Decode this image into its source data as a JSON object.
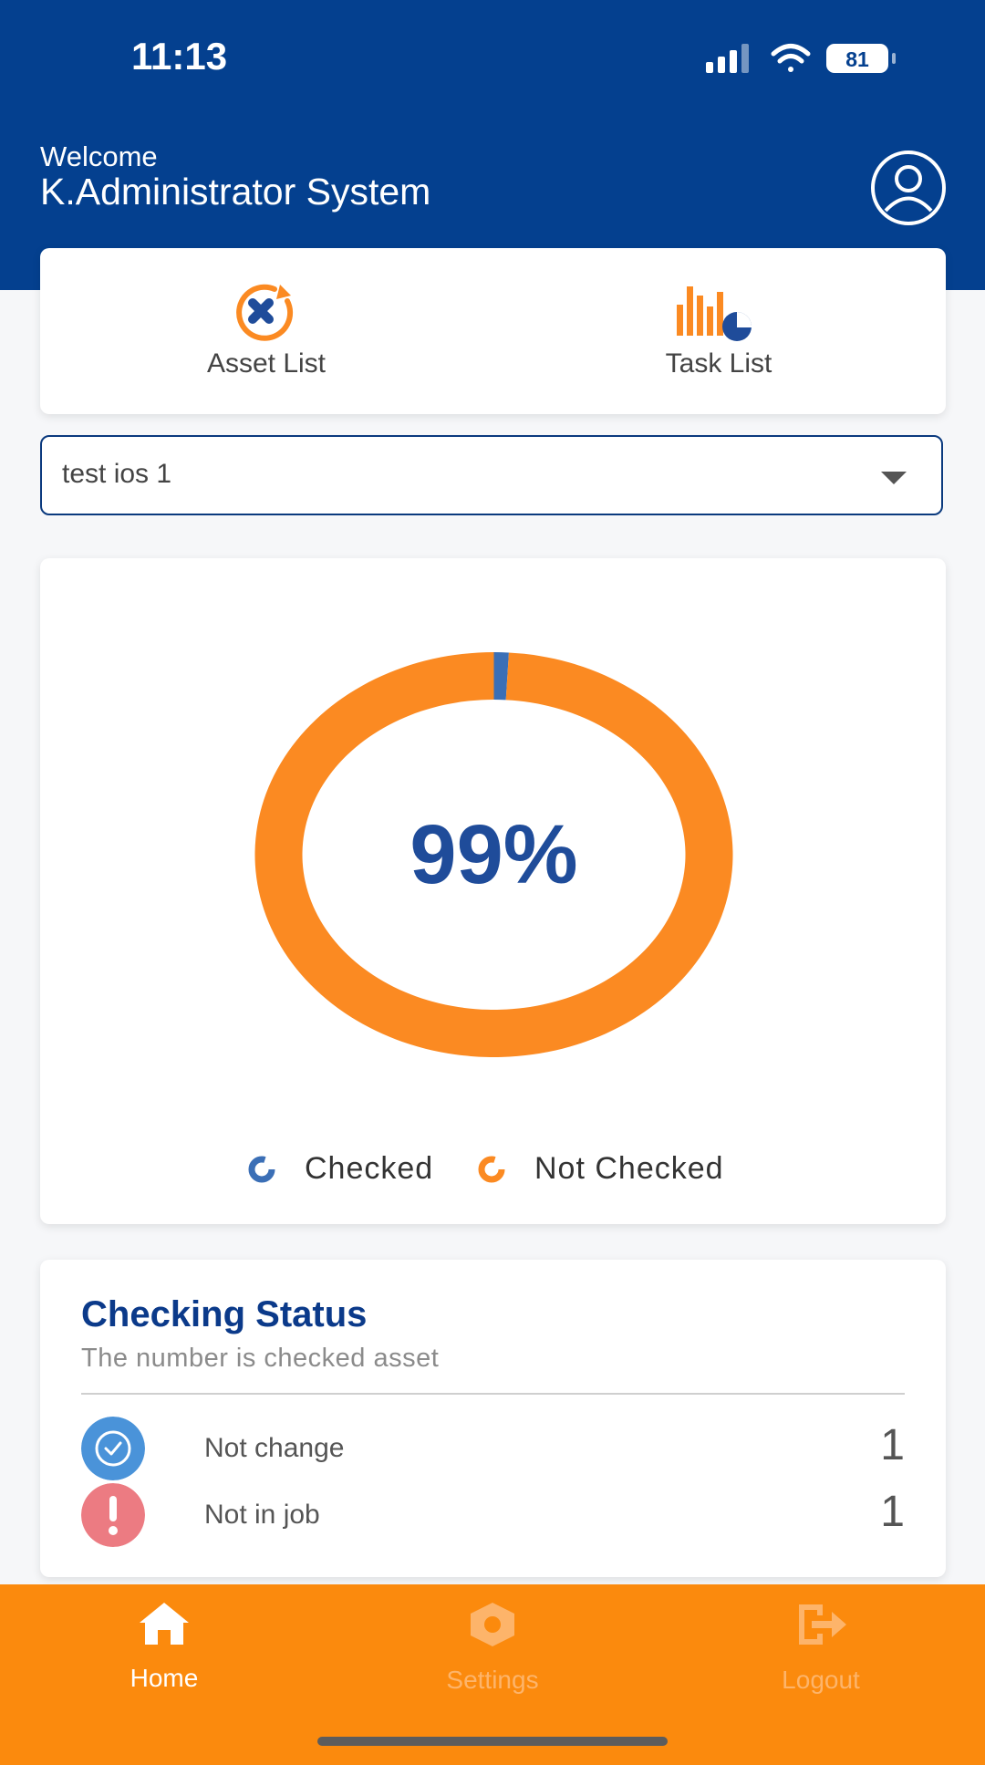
{
  "status_bar": {
    "time": "11:13",
    "battery": "81"
  },
  "header": {
    "welcome": "Welcome",
    "username": "K.Administrator System"
  },
  "quick_actions": [
    {
      "label": "Asset List",
      "icon": "asset-list-icon"
    },
    {
      "label": "Task List",
      "icon": "task-list-icon"
    }
  ],
  "dropdown": {
    "selected": "test ios 1"
  },
  "chart_data": {
    "type": "donut",
    "center_label": "99%",
    "slices": [
      {
        "name": "Checked",
        "value": 1,
        "color": "#3b6fb6"
      },
      {
        "name": "Not Checked",
        "value": 99,
        "color": "#fb8a22"
      }
    ],
    "legend": [
      "Checked",
      "Not Checked"
    ]
  },
  "checking_status": {
    "title": "Checking Status",
    "subtitle": "The number is checked asset",
    "rows": [
      {
        "label": "Not change",
        "count": "1",
        "icon": "check-circle-icon",
        "color": "#4a93d9"
      },
      {
        "label": "Not in job",
        "count": "1",
        "icon": "exclamation-icon",
        "color": "#ec7b82"
      }
    ]
  },
  "tabs": [
    {
      "label": "Home",
      "icon": "home-icon",
      "active": true
    },
    {
      "label": "Settings",
      "icon": "settings-icon",
      "active": false
    },
    {
      "label": "Logout",
      "icon": "logout-icon",
      "active": false
    }
  ]
}
